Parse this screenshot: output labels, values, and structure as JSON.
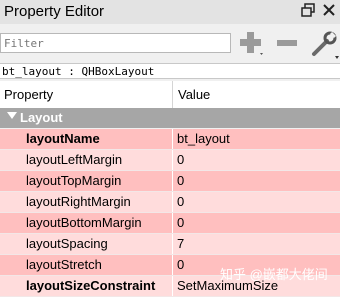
{
  "window": {
    "title": "Property Editor",
    "float_icon": "dock-float-icon",
    "close_icon": "close-icon"
  },
  "filter": {
    "placeholder": "Filter"
  },
  "toolbar": {
    "add_icon": "plus-icon",
    "remove_icon": "minus-icon",
    "configure_icon": "wrench-icon"
  },
  "object_label": "bt_layout : QHBoxLayout",
  "table": {
    "headers": {
      "property": "Property",
      "value": "Value"
    },
    "group": "Layout",
    "rows": [
      {
        "name": "layoutName",
        "value": "bt_layout",
        "bold": true
      },
      {
        "name": "layoutLeftMargin",
        "value": "0",
        "bold": false
      },
      {
        "name": "layoutTopMargin",
        "value": "0",
        "bold": false
      },
      {
        "name": "layoutRightMargin",
        "value": "0",
        "bold": false
      },
      {
        "name": "layoutBottomMargin",
        "value": "0",
        "bold": false
      },
      {
        "name": "layoutSpacing",
        "value": "7",
        "bold": false
      },
      {
        "name": "layoutStretch",
        "value": "0",
        "bold": false
      },
      {
        "name": "layoutSizeConstraint",
        "value": "SetMaximumSize",
        "bold": true
      }
    ]
  },
  "watermark": "知乎 @嵌都大佬间"
}
